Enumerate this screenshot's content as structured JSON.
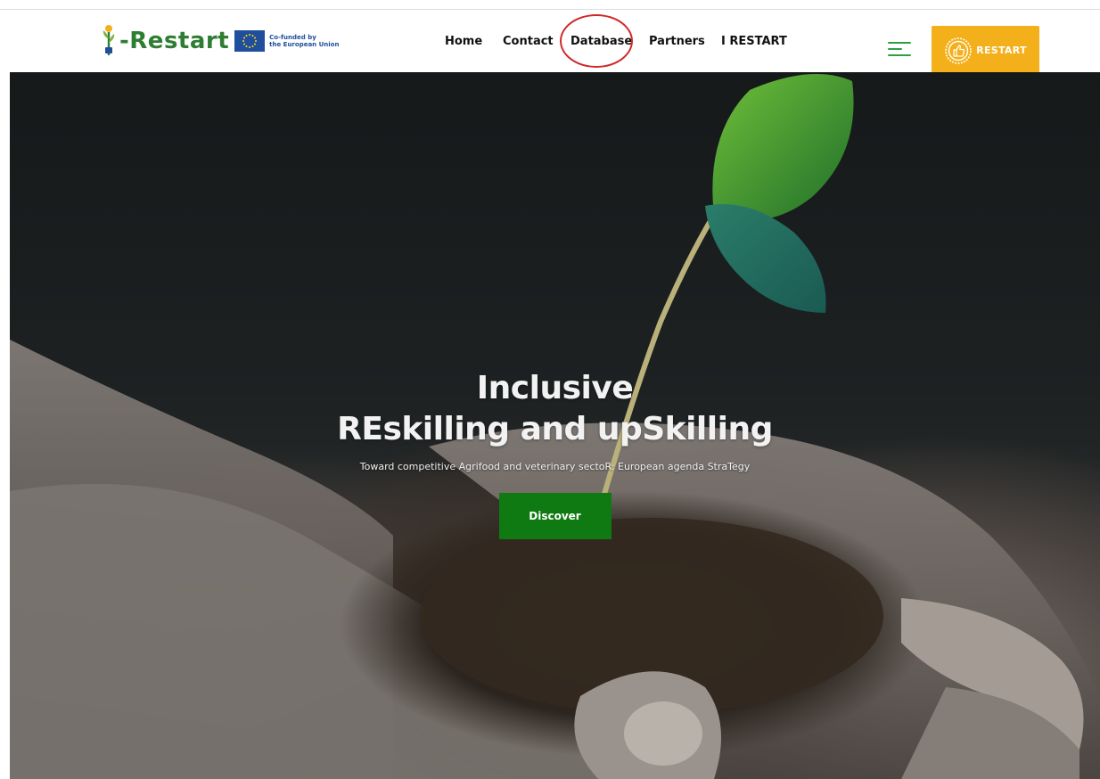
{
  "brand": {
    "logo_text": "-Restart",
    "eu_line1": "Co-funded by",
    "eu_line2": "the European Union",
    "accent_green": "#2e7d32"
  },
  "nav": {
    "items": [
      {
        "label": "Home"
      },
      {
        "label": "Contact"
      },
      {
        "label": "Database",
        "highlighted": true
      },
      {
        "label": "Partners"
      },
      {
        "label": "I RESTART"
      }
    ],
    "highlight_color": "#cf2a2a"
  },
  "menu_toggle": {
    "icon": "hamburger-menu-icon",
    "color": "#2e9e44"
  },
  "cta": {
    "label": "RESTART",
    "icon": "thumbs-up-badge-icon",
    "color": "#f4b01a"
  },
  "hero": {
    "title_line1": "Inclusive",
    "title_line2": "REskilling and upSkilling",
    "subtitle": "Toward competitive Agrifood and veterinary sectoR: European agenda StraTegy",
    "button_label": "Discover",
    "button_color": "#0f7a11"
  }
}
